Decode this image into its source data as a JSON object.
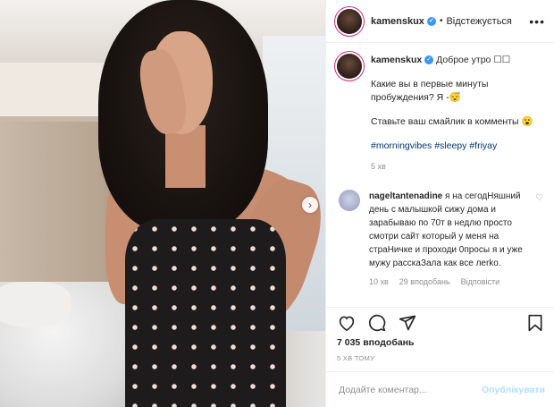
{
  "header": {
    "username": "kamenskux",
    "separator": "•",
    "follow_status": "Відстежується",
    "more_icon": "more-horizontal-icon"
  },
  "caption": {
    "username": "kamenskux",
    "line1": "Доброе утро ☐☐",
    "line2": "Какие вы в первые минуты пробуждения? Я -😴",
    "line3": "Ставьте ваш смайлик в комменты 😮",
    "hashtags": "#morningvibes #sleepy #friyay",
    "time": "5 хв"
  },
  "comment": {
    "username": "nageltantenadine",
    "text": "я на сегодНяшний день с малышкой сижу дома и зарабываю по 70т в недлю просто смотри сайт который у меня на страНичке и проходи 0просы я и уже мужу расскаЗала как все лerko.",
    "time": "10 хв",
    "likes": "29 вподобань",
    "reply": "Відповісти"
  },
  "actions": {
    "like_icon": "heart-icon",
    "comment_icon": "comment-icon",
    "share_icon": "paper-plane-icon",
    "save_icon": "bookmark-icon"
  },
  "likes_count": "7 035 вподобань",
  "posted_ago": "5 ХВ ТОМУ",
  "add_comment": {
    "placeholder": "Додайте коментар...",
    "publish": "Опублікувати"
  }
}
